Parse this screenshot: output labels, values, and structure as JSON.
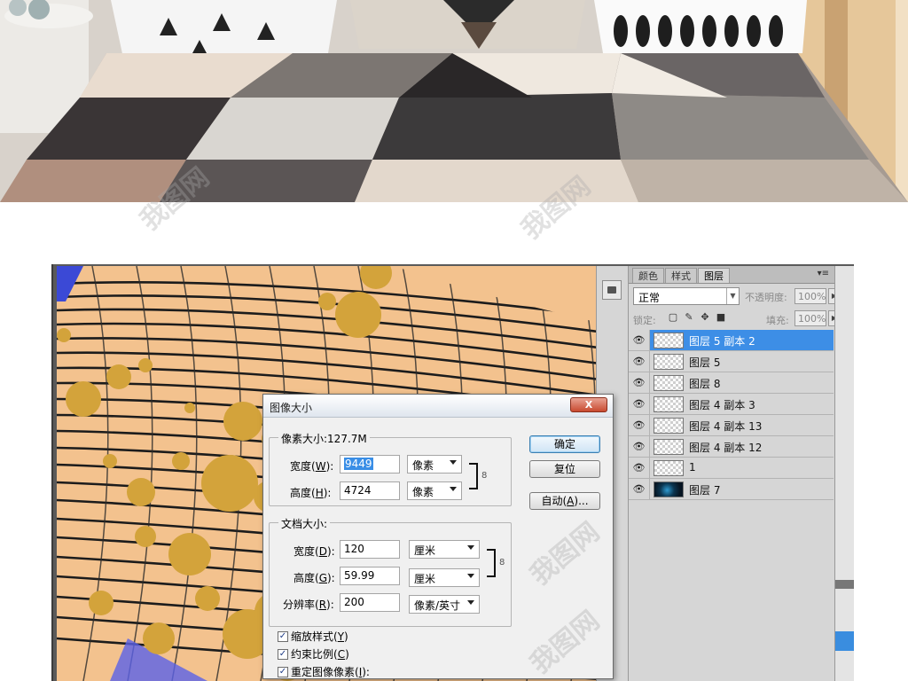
{
  "layers_panel": {
    "tabs": [
      "颜色",
      "样式",
      "图层"
    ],
    "active_tab": "图层",
    "menu_glyph": "▾≡",
    "blend_mode": "正常",
    "opacity_label": "不透明度:",
    "opacity_value": "100%",
    "lock_label": "锁定:",
    "fill_label": "填充:",
    "fill_value": "100%",
    "layers": [
      {
        "name": "图层 5 副本 2",
        "selected": true,
        "thumb": "transparent"
      },
      {
        "name": "图层 5",
        "selected": false,
        "thumb": "transparent"
      },
      {
        "name": "图层 8",
        "selected": false,
        "thumb": "transparent"
      },
      {
        "name": "图层 4 副本 3",
        "selected": false,
        "thumb": "transparent"
      },
      {
        "name": "图层 4 副本 13",
        "selected": false,
        "thumb": "transparent"
      },
      {
        "name": "图层 4 副本 12",
        "selected": false,
        "thumb": "transparent"
      },
      {
        "name": "1",
        "selected": false,
        "thumb": "transparent"
      },
      {
        "name": "图层 7",
        "selected": false,
        "thumb": "dark"
      }
    ]
  },
  "dialog": {
    "title": "图像大小",
    "close_label": "X",
    "pixel_dims_legend": "像素大小:127.7M",
    "px_width_label": "宽度(",
    "px_width_key": "W",
    "px_width_value": "9449",
    "px_width_unit": "像素",
    "px_height_label": "高度(",
    "px_height_key": "H",
    "px_height_value": "4724",
    "px_height_unit": "像素",
    "doc_legend": "文档大小:",
    "doc_width_label": "宽度(",
    "doc_width_key": "D",
    "doc_width_value": "120",
    "doc_width_unit": "厘米",
    "doc_height_label": "高度(",
    "doc_height_key": "G",
    "doc_height_value": "59.99",
    "doc_height_unit": "厘米",
    "res_label": "分辨率(",
    "res_key": "R",
    "res_value": "200",
    "res_unit": "像素/英寸",
    "ok_label": "确定",
    "reset_label": "复位",
    "auto_label": "自动(",
    "auto_key": "A",
    "auto_suffix": ")...",
    "checkboxes": [
      {
        "label": "缩放样式(",
        "key": "Y",
        "checked": true
      },
      {
        "label": "约束比例(",
        "key": "C",
        "checked": true
      },
      {
        "label": "重定图像像素(",
        "key": "I",
        "checked": true
      }
    ]
  },
  "watermark": "我图网"
}
